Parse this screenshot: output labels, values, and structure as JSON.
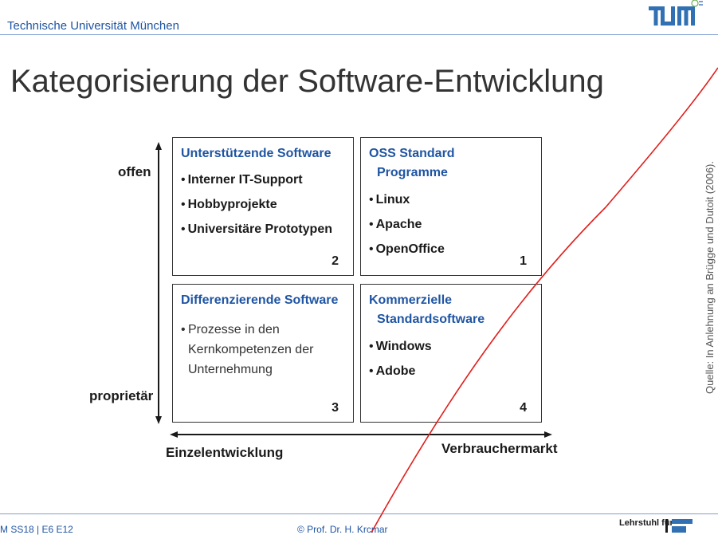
{
  "header": {
    "university": "Technische Universität München",
    "logo_text": "TUM"
  },
  "slide": {
    "title": "Kategorisierung der Software-Entwicklung"
  },
  "axes": {
    "y_top": "offen",
    "y_bottom": "proprietär",
    "x_left": "Einzelentwicklung",
    "x_right": "Verbrauchermarkt"
  },
  "quadrants": {
    "q2": {
      "title": "Unterstützende Software",
      "items": [
        "Interner IT-Support",
        "Hobbyprojekte",
        "Universitäre Prototypen"
      ],
      "number": "2"
    },
    "q1": {
      "title_line1": "OSS Standard",
      "title_line2": "Programme",
      "items": [
        "Linux",
        "Apache",
        "OpenOffice"
      ],
      "number": "1"
    },
    "q3": {
      "title": "Differenzierende Software",
      "item": "Prozesse in den Kernkompetenzen der Unternehmung",
      "number": "3"
    },
    "q4": {
      "title_line1": "Kommerzielle",
      "title_line2": "Standardsoftware",
      "items": [
        "Windows",
        "Adobe"
      ],
      "number": "4"
    }
  },
  "source_note": "Quelle: In Anlehnung an Brügge und Dutoit (2006).",
  "footer": {
    "left": "M SS18 | E6 E12",
    "center": "© Prof. Dr. H. Krcmar",
    "chair": "Lehrstuhl für"
  },
  "colors": {
    "accent_blue": "#1f55a3",
    "annotation_red": "#e0201e"
  }
}
